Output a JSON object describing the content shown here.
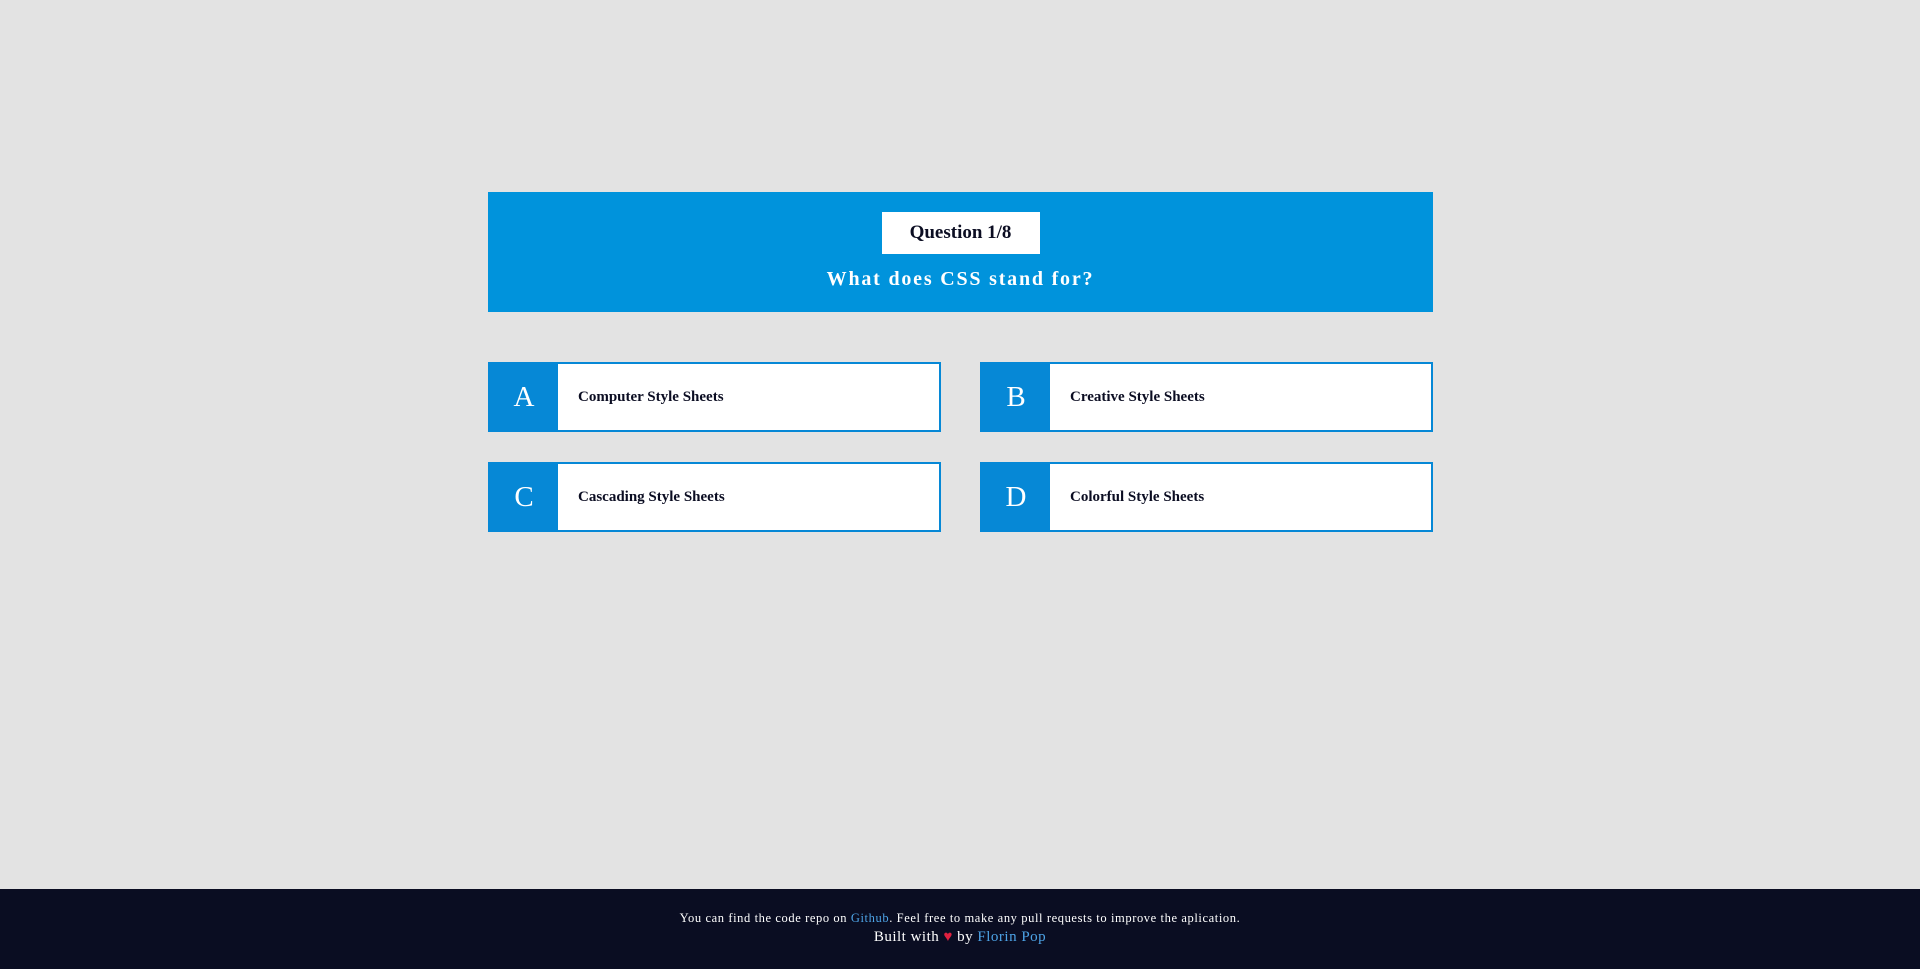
{
  "quiz": {
    "counter": "Question 1/8",
    "question": "What does CSS stand for?",
    "answers": [
      {
        "letter": "A",
        "text": "Computer Style Sheets"
      },
      {
        "letter": "B",
        "text": "Creative Style Sheets"
      },
      {
        "letter": "C",
        "text": "Cascading Style Sheets"
      },
      {
        "letter": "D",
        "text": "Colorful Style Sheets"
      }
    ]
  },
  "footer": {
    "line1_prefix": "You can find the code repo on ",
    "line1_link": "Github",
    "line1_suffix": ". Feel free to make any pull requests to improve the aplication.",
    "line2_prefix": "Built with ",
    "heart": "♥",
    "line2_by": " by ",
    "author_link": "Florin Pop"
  },
  "colors": {
    "background": "#e3e3e3",
    "header": "#0093dc",
    "answer_accent": "#0688d6",
    "footer": "#0a0d22",
    "link": "#4da3e6",
    "heart": "#e0203f"
  }
}
